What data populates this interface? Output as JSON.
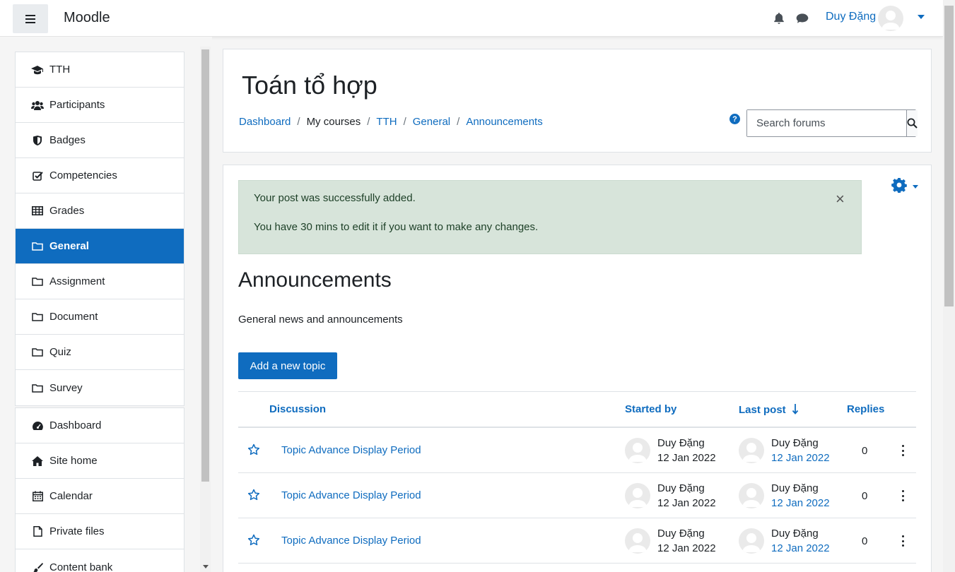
{
  "navbar": {
    "brand": "Moodle",
    "user_name": "Duy Đặng"
  },
  "drawer": {
    "course_items": [
      {
        "label": "TTH",
        "icon": "graduation-cap-icon"
      },
      {
        "label": "Participants",
        "icon": "users-icon"
      },
      {
        "label": "Badges",
        "icon": "shield-icon"
      },
      {
        "label": "Competencies",
        "icon": "checkbox-icon"
      },
      {
        "label": "Grades",
        "icon": "table-icon"
      },
      {
        "label": "General",
        "icon": "folder-icon",
        "active": true
      },
      {
        "label": "Assignment",
        "icon": "folder-icon"
      },
      {
        "label": "Document",
        "icon": "folder-icon"
      },
      {
        "label": "Quiz",
        "icon": "folder-icon"
      },
      {
        "label": "Survey",
        "icon": "folder-icon"
      }
    ],
    "site_items": [
      {
        "label": "Dashboard",
        "icon": "dashboard-icon"
      },
      {
        "label": "Site home",
        "icon": "home-icon"
      },
      {
        "label": "Calendar",
        "icon": "calendar-icon"
      },
      {
        "label": "Private files",
        "icon": "file-icon"
      },
      {
        "label": "Content bank",
        "icon": "brush-icon"
      }
    ]
  },
  "header": {
    "course_title": "Toán tổ hợp",
    "breadcrumb": [
      "Dashboard",
      "My courses",
      "TTH",
      "General",
      "Announcements"
    ],
    "separator": "/",
    "search_placeholder": "Search forums"
  },
  "alert": {
    "line1": "Your post was successfully added.",
    "line2": "You have 30 mins to edit it if you want to make any changes.",
    "close": "×"
  },
  "forum": {
    "title": "Announcements",
    "intro": "General news and announcements",
    "add_button": "Add a new topic"
  },
  "table": {
    "headers": {
      "discussion": "Discussion",
      "started_by": "Started by",
      "last_post": "Last post",
      "replies": "Replies"
    },
    "rows": [
      {
        "topic": "Topic Advance Display Period",
        "starter": "Duy Đặng",
        "start_date": "12 Jan 2022",
        "last_by": "Duy Đặng",
        "last_date": "12 Jan 2022",
        "replies": "0"
      },
      {
        "topic": "Topic Advance Display Period",
        "starter": "Duy Đặng",
        "start_date": "12 Jan 2022",
        "last_by": "Duy Đặng",
        "last_date": "12 Jan 2022",
        "replies": "0"
      },
      {
        "topic": "Topic Advance Display Period",
        "starter": "Duy Đặng",
        "start_date": "12 Jan 2022",
        "last_by": "Duy Đặng",
        "last_date": "12 Jan 2022",
        "replies": "0"
      }
    ]
  },
  "colors": {
    "primary": "#0f6cbf",
    "alert_bg": "#d7e4da",
    "text": "#1d2125"
  }
}
